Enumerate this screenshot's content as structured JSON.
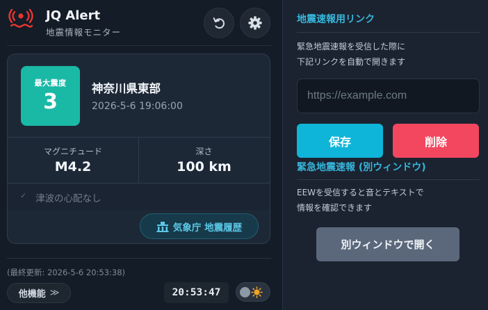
{
  "header": {
    "title": "JQ Alert",
    "subtitle": "地震情報モニター",
    "icon": "earthquake-alert-icon",
    "accent_color": "#e8362f"
  },
  "earthquake": {
    "intensity_label": "最大震度",
    "intensity_value": "3",
    "intensity_color": "#1ab9a6",
    "location": "神奈川県東部",
    "time": "2026-5-6 19:06:00",
    "magnitude_label": "マグニチュード",
    "magnitude_value": "M4.2",
    "depth_label": "深さ",
    "depth_value": "100 km",
    "tsunami_check": "✓",
    "tsunami_text": "津波の心配なし",
    "jma_button_label": "気象庁 地震履歴"
  },
  "footer": {
    "last_update": "(最終更新: 2026-5-6 20:53:38)",
    "more_label": "他機能",
    "more_chevron": "≫",
    "clock": "20:53:47"
  },
  "link_section": {
    "title": "地震速報用リンク",
    "description_line1": "緊急地震速報を受信した際に",
    "description_line2": "下記リンクを自動で開きます",
    "input_placeholder": "https://example.com",
    "input_value": "",
    "save_label": "保存",
    "delete_label": "削除",
    "save_color": "#0fb5d8",
    "delete_color": "#f2475f"
  },
  "window_section": {
    "title": "緊急地震速報 (別ウィンドウ)",
    "description_line1": "EEWを受信すると音とテキストで",
    "description_line2": "情報を確認できます",
    "open_label": "別ウィンドウで開く"
  }
}
